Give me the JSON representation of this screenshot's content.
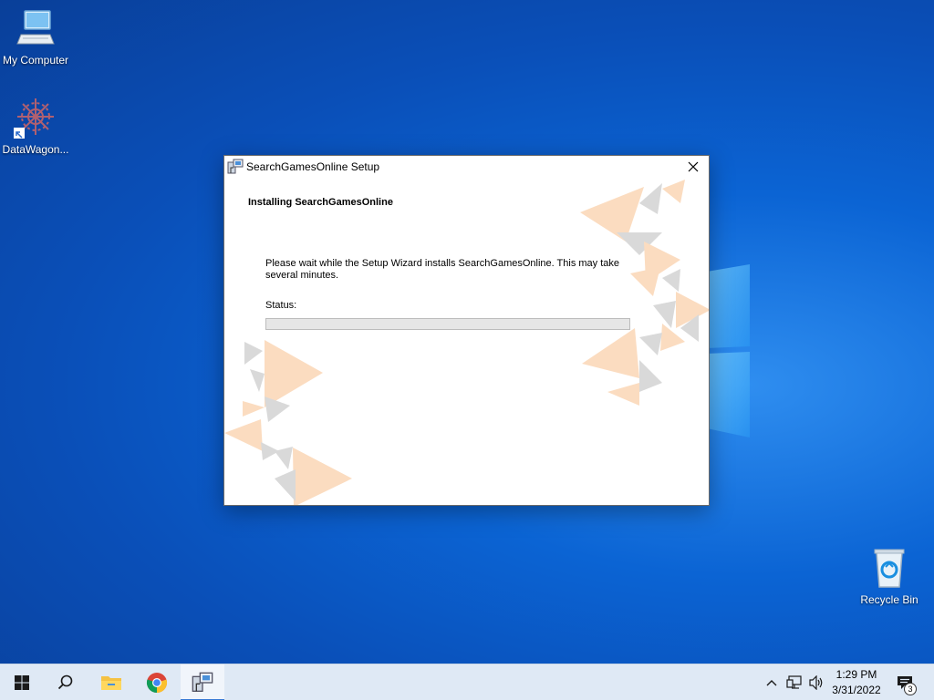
{
  "desktop": {
    "icons": [
      {
        "label": "My Computer",
        "icon": "computer-icon"
      },
      {
        "label": "DataWagon...",
        "icon": "datawagon-icon"
      },
      {
        "label": "Recycle Bin",
        "icon": "recycle-bin-icon"
      }
    ]
  },
  "dialog": {
    "title": "SearchGamesOnline Setup",
    "heading": "Installing SearchGamesOnline",
    "message": "Please wait while the Setup Wizard installs SearchGamesOnline.  This may take several minutes.",
    "status_label": "Status:",
    "progress": 0,
    "colors": {
      "accent_triangle": "#fbdcc0",
      "gray_triangle": "#d9d9d9"
    }
  },
  "taskbar": {
    "buttons": [
      {
        "name": "start",
        "icon": "windows-logo-icon"
      },
      {
        "name": "search",
        "icon": "search-icon"
      },
      {
        "name": "file-explorer",
        "icon": "folder-icon"
      },
      {
        "name": "chrome",
        "icon": "chrome-icon"
      },
      {
        "name": "setup",
        "icon": "installer-icon",
        "active": true
      }
    ],
    "tray": {
      "time": "1:29 PM",
      "date": "3/31/2022",
      "notification_count": "3"
    }
  }
}
